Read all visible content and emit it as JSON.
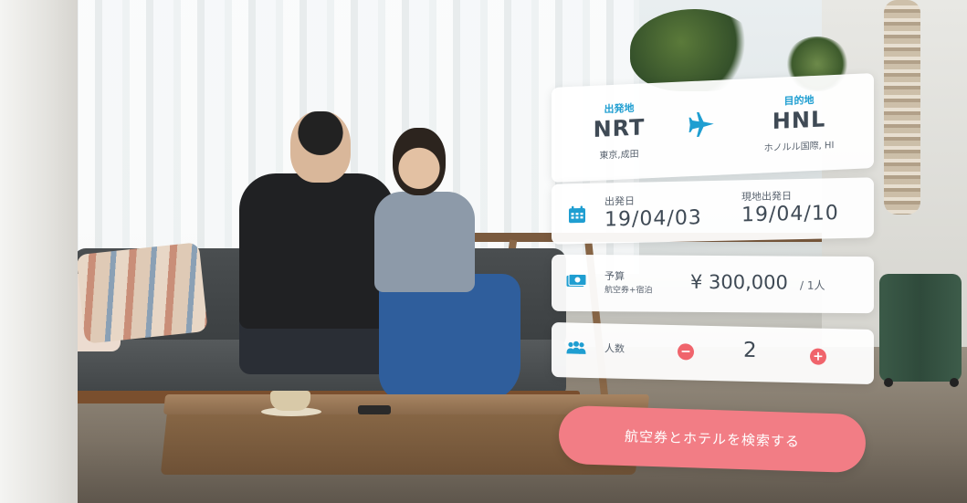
{
  "route": {
    "origin_label": "出発地",
    "origin_code": "NRT",
    "origin_name": "東京,成田",
    "dest_label": "目的地",
    "dest_code": "HNL",
    "dest_name": "ホノルル国際, HI",
    "icon": "airplane-icon"
  },
  "dates": {
    "depart_label": "出発日",
    "depart_value": "19/04/03",
    "return_label": "現地出発日",
    "return_value": "19/04/10",
    "icon": "calendar-icon"
  },
  "budget": {
    "label": "予算",
    "sub_label": "航空券+宿泊",
    "amount": "¥ 300,000",
    "per": "/ 1人",
    "icon": "money-icon"
  },
  "people": {
    "label": "人数",
    "count": "2",
    "minus_symbol": "−",
    "plus_symbol": "+",
    "icon": "people-icon"
  },
  "search_button": {
    "label": "航空券とホテルを検索する"
  },
  "colors": {
    "accent_blue": "#1f9ed1",
    "accent_pink": "#f27d85",
    "control_red": "#f0646c",
    "text_dark": "#3f4a55"
  }
}
